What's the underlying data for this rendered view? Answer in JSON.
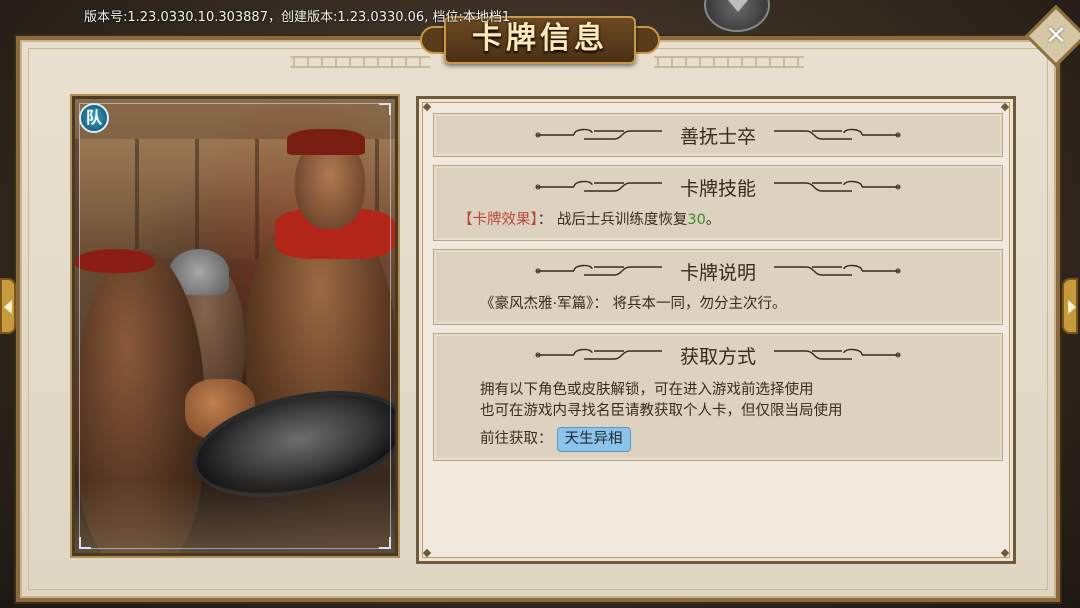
{
  "version_text": "版本号:1.23.0330.10.303887，创建版本:1.23.0330.06, 档位:本地档1",
  "title": "卡牌信息",
  "close_symbol": "✕",
  "card": {
    "badge": "队"
  },
  "sections": {
    "card_name": {
      "title": "善抚士卒"
    },
    "skill": {
      "title": "卡牌技能",
      "effect_label": "【卡牌效果】",
      "separator": "：",
      "effect_text_before": "战后士兵训练度恢复",
      "effect_value": "30",
      "effect_text_after": "。"
    },
    "description": {
      "title": "卡牌说明",
      "quote_source": "《豪风杰雅·军篇》：",
      "quote_text": "将兵本一同，勿分主次行。"
    },
    "obtain": {
      "title": "获取方式",
      "line1": "拥有以下角色或皮肤解锁，可在进入游戏前选择使用",
      "line2": "也可在游戏内寻找名臣请教获取个人卡，但仅限当局使用",
      "goto_label": "前往获取：",
      "goto_button": "天生异相"
    }
  },
  "colors": {
    "accent_red": "#b8463a",
    "value_green": "#3f8a2a",
    "tag_blue": "#8cc4ea"
  }
}
